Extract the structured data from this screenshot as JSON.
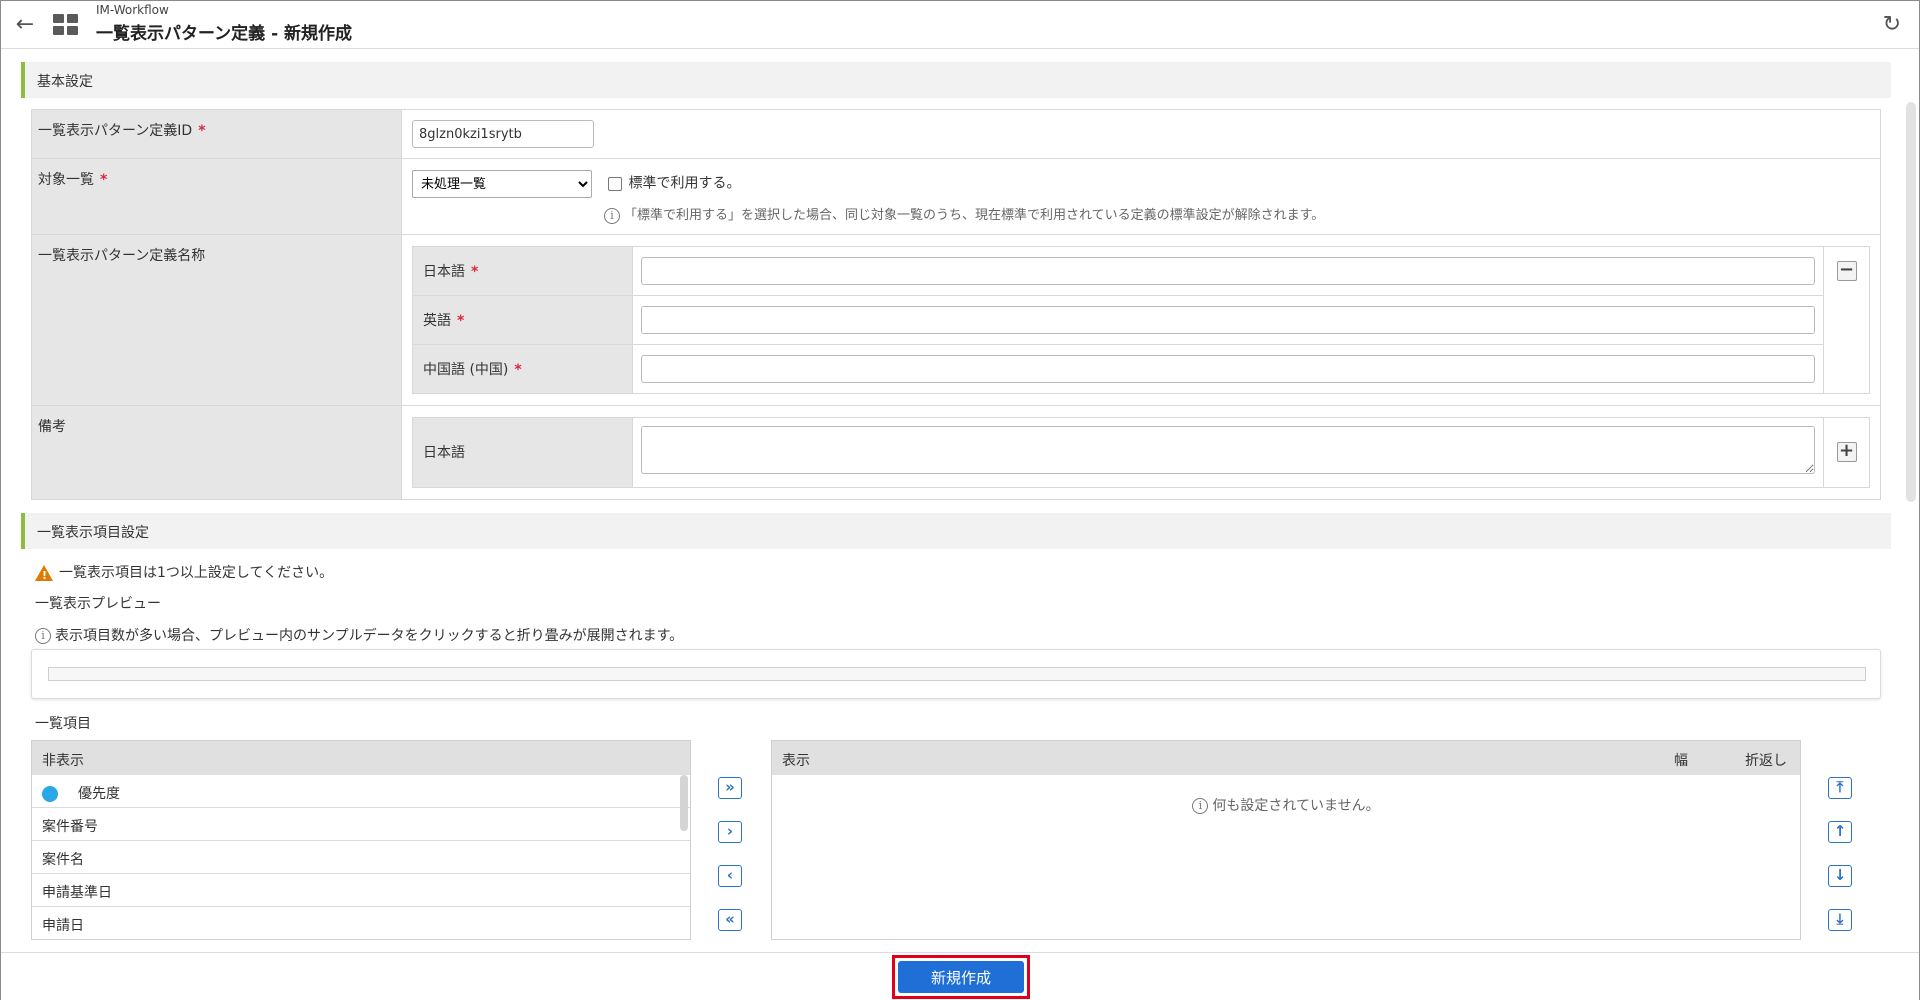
{
  "header": {
    "app_name": "IM-Workflow",
    "title": "一覧表示パターン定義 - 新規作成",
    "back_glyph": "←",
    "reload_glyph": "↻"
  },
  "basic": {
    "section_title": "基本設定",
    "id_label": "一覧表示パターン定義ID",
    "id_value": "8glzn0kzi1srytb",
    "target_label": "対象一覧",
    "target_selected": "未処理一覧",
    "default_checkbox_label": "標準で利用する。",
    "default_note": "「標準で利用する」を選択した場合、同じ対象一覧のうち、現在標準で利用されている定義の標準設定が解除されます。",
    "name_label": "一覧表示パターン定義名称",
    "langs": [
      {
        "label": "日本語",
        "value": ""
      },
      {
        "label": "英語",
        "value": ""
      },
      {
        "label": "中国語 (中国)",
        "value": ""
      }
    ],
    "remarks_label": "備考",
    "remarks_lang": "日本語",
    "required_mark": "*",
    "minus_glyph": "−",
    "plus_glyph": "+"
  },
  "items": {
    "section_title": "一覧表示項目設定",
    "warning": "一覧表示項目は1つ以上設定してください。",
    "preview_label": "一覧表示プレビュー",
    "preview_note": "表示項目数が多い場合、プレビュー内のサンプルデータをクリックすると折り畳みが展開されます。",
    "list_label": "一覧項目",
    "hidden_header": "非表示",
    "hidden_items": [
      "優先度",
      "案件番号",
      "案件名",
      "申請基準日",
      "申請日"
    ],
    "shown_header": "表示",
    "width_header": "幅",
    "wrap_header": "折返し",
    "empty_message": "何も設定されていません。",
    "move_glyphs": [
      "»",
      "›",
      "‹",
      "«"
    ],
    "order_glyphs": [
      "⤒",
      "↑",
      "↓",
      "⤓"
    ],
    "priority_color": "#2aa7e6"
  },
  "footer": {
    "create_label": "新規作成"
  }
}
